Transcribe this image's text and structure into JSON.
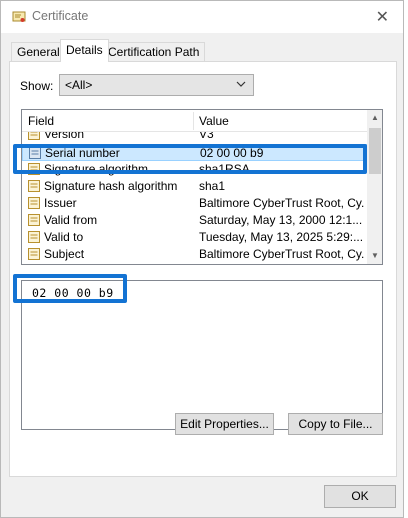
{
  "window": {
    "title": "Certificate",
    "close_glyph": "✕"
  },
  "tabs": [
    {
      "label": "General",
      "active": false
    },
    {
      "label": "Details",
      "active": true
    },
    {
      "label": "Certification Path",
      "active": false
    }
  ],
  "show": {
    "label": "Show:",
    "selected": "<All>"
  },
  "list": {
    "columns": {
      "field": "Field",
      "value": "Value"
    },
    "rows": [
      {
        "field": "Version",
        "value": "V3",
        "selected": false
      },
      {
        "field": "Serial number",
        "value": "02 00 00 b9",
        "selected": true
      },
      {
        "field": "Signature algorithm",
        "value": "sha1RSA",
        "selected": false
      },
      {
        "field": "Signature hash algorithm",
        "value": "sha1",
        "selected": false
      },
      {
        "field": "Issuer",
        "value": "Baltimore CyberTrust Root, Cy...",
        "selected": false
      },
      {
        "field": "Valid from",
        "value": "Saturday, May 13, 2000 12:1...",
        "selected": false
      },
      {
        "field": "Valid to",
        "value": "Tuesday, May 13, 2025 5:29:...",
        "selected": false
      },
      {
        "field": "Subject",
        "value": "Baltimore CyberTrust Root, Cy...",
        "selected": false
      }
    ]
  },
  "detail_value": "02 00 00 b9",
  "buttons": {
    "edit_properties": "Edit Properties...",
    "copy_to_file": "Copy to File...",
    "ok": "OK"
  },
  "icons": {
    "title": "certificate-icon",
    "row": "certificate-field-icon",
    "close": "close-icon",
    "dropdown": "chevron-down-icon"
  },
  "colors": {
    "highlight_border": "#1373d3",
    "selection_bg": "#cce8ff"
  }
}
